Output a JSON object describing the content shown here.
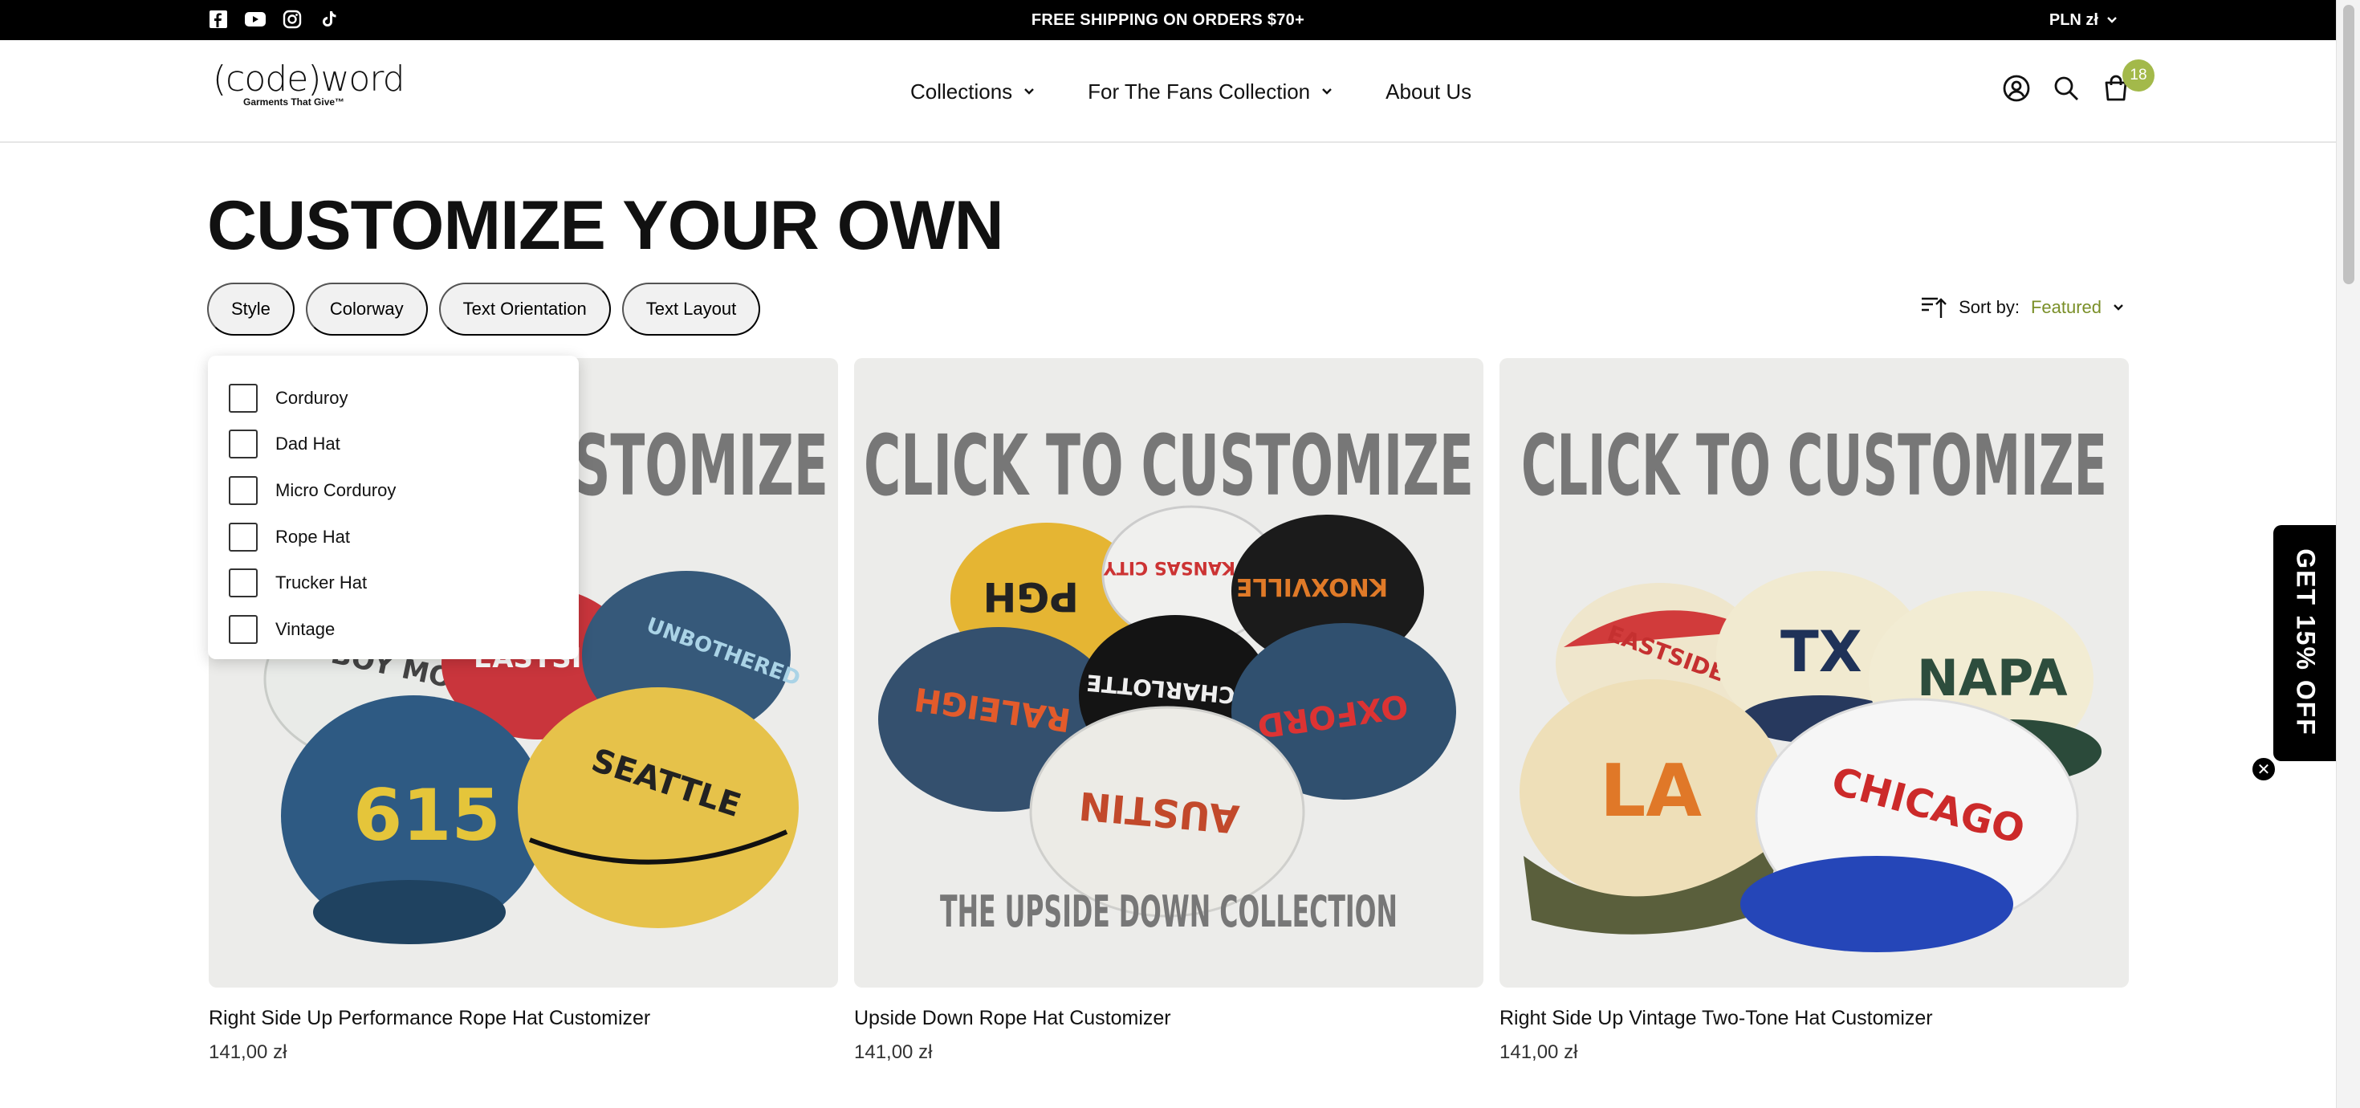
{
  "topbar": {
    "social": [
      "facebook-icon",
      "youtube-icon",
      "instagram-icon",
      "tiktok-icon"
    ],
    "announcement": "FREE SHIPPING ON ORDERS $70+",
    "currency": "PLN zł"
  },
  "header": {
    "logo_text": "(code)word",
    "logo_tagline": "Garments That Give™",
    "nav": [
      {
        "label": "Collections",
        "has_dropdown": true
      },
      {
        "label": "For The Fans Collection",
        "has_dropdown": true
      },
      {
        "label": "About Us",
        "has_dropdown": false
      }
    ],
    "icons": [
      "account-icon",
      "search-icon",
      "cart-icon"
    ],
    "cart_count": "18"
  },
  "page": {
    "title": "CUSTOMIZE YOUR OWN",
    "filters": [
      "Style",
      "Colorway",
      "Text Orientation",
      "Text Layout"
    ],
    "sort_label": "Sort by:",
    "sort_value": "Featured"
  },
  "style_dropdown": {
    "options": [
      "Corduroy",
      "Dad Hat",
      "Micro Corduroy",
      "Rope Hat",
      "Trucker Hat",
      "Vintage"
    ]
  },
  "products": [
    {
      "title": "Right Side Up Performance Rope Hat Customizer",
      "price": "141,00 zł",
      "image_text": "CLICK TO CUSTOMIZE",
      "hats": [
        "BOY MOM",
        "EASTSIDE",
        "UNBOTHERED",
        "615",
        "SEATTLE"
      ]
    },
    {
      "title": "Upside Down Rope Hat Customizer",
      "price": "141,00 zł",
      "image_text": "CLICK TO CUSTOMIZE",
      "image_subtext": "THE UPSIDE DOWN COLLECTION",
      "hats": [
        "PGH",
        "KANSAS CITY",
        "KNOXVILLE",
        "RALEIGH",
        "CHARLOTTE",
        "OXFORD",
        "AUSTIN"
      ]
    },
    {
      "title": "Right Side Up Vintage Two-Tone Hat Customizer",
      "price": "141,00 zł",
      "image_text": "CLICK TO CUSTOMIZE",
      "hats": [
        "EASTSIDE",
        "TX",
        "NAPA",
        "LA",
        "CHICAGO"
      ]
    }
  ],
  "promo": {
    "label": "GET 15% OFF",
    "close": "✕"
  },
  "colors": {
    "topbar_bg": "#000000",
    "accent": "#7a8f28",
    "badge_bg": "#a3b94a",
    "pill_bg": "#f1f1f1",
    "image_bg": "#ececea"
  }
}
